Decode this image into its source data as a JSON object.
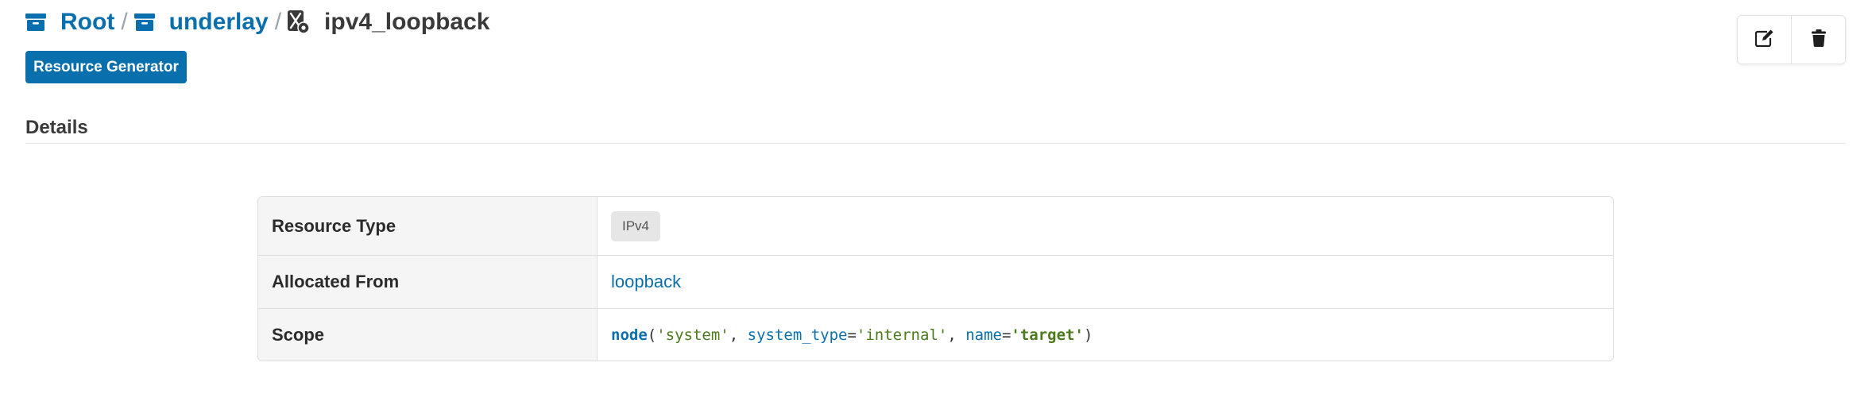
{
  "breadcrumb": {
    "items": [
      {
        "label": "Root",
        "icon": "archive-box-icon"
      },
      {
        "label": "underlay",
        "icon": "archive-box-icon"
      }
    ],
    "separator": "/",
    "current": {
      "label": "ipv4_loopback",
      "icon": "resource-generator-icon"
    }
  },
  "toolbar": {
    "resource_generator_label": "Resource Generator",
    "edit_icon": "edit-icon",
    "delete_icon": "trash-icon"
  },
  "details": {
    "title": "Details",
    "rows": [
      {
        "label": "Resource Type",
        "value": "IPv4"
      },
      {
        "label": "Allocated From",
        "value": "loopback"
      },
      {
        "label": "Scope"
      }
    ],
    "scope_tokens": {
      "fn": "node",
      "open": "(",
      "arg1": "'system'",
      "comma1": ", ",
      "kw1": "system_type",
      "eq1": "=",
      "arg2": "'internal'",
      "comma2": ", ",
      "kw2": "name",
      "eq2": "=",
      "arg3": "'target'",
      "close": ")"
    }
  },
  "colors": {
    "primary": "#0a6fad",
    "string": "#4a7a1b",
    "label_bg": "#f5f5f5",
    "badge_bg": "#e6e6e6"
  }
}
